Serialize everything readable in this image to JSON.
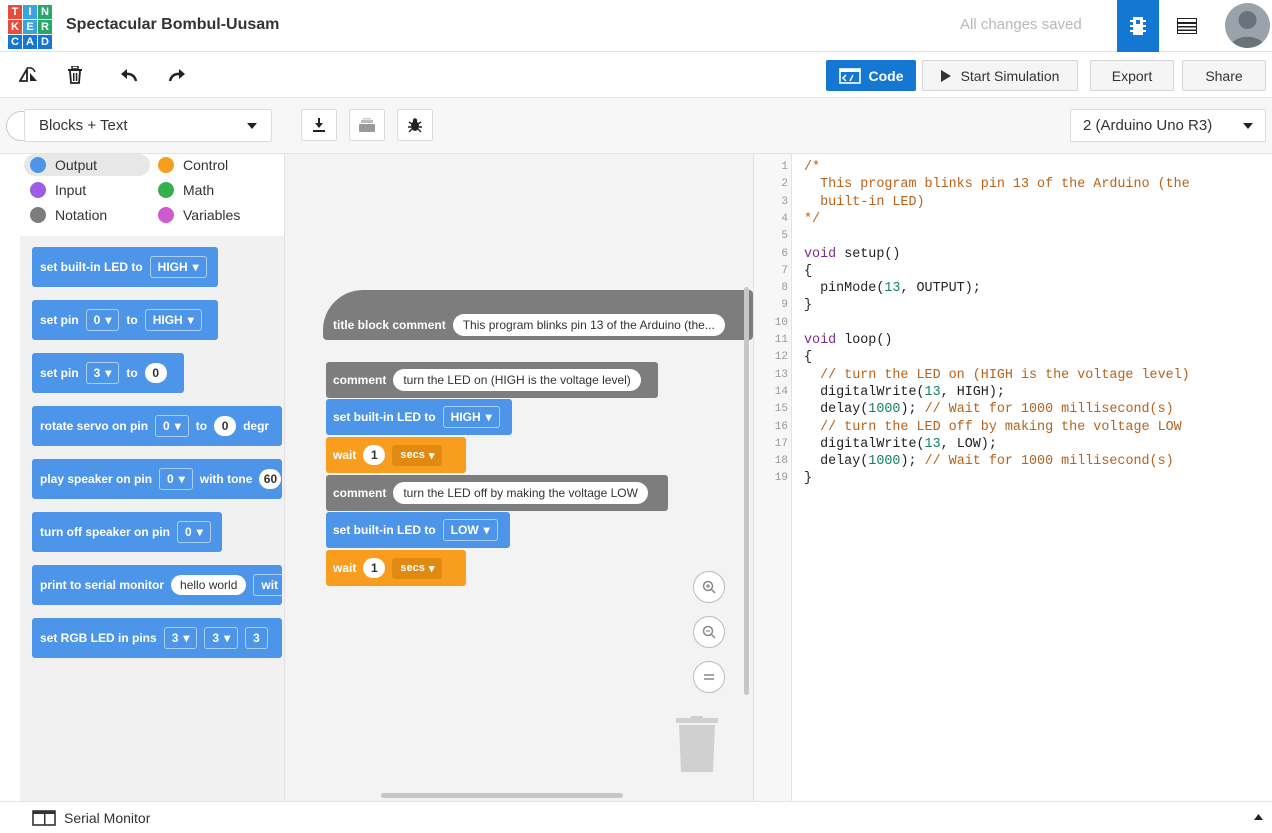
{
  "header": {
    "logo_letters": [
      "T",
      "I",
      "N",
      "K",
      "E",
      "R",
      "C",
      "A",
      "D"
    ],
    "logo_colors": [
      "#e64d3d",
      "#3aa5dc",
      "#27a86a",
      "#e64d3d",
      "#3aa5dc",
      "#27a86a",
      "#1477d2",
      "#1477d2",
      "#1477d2"
    ],
    "project_title": "Spectacular Bombul-Uusam",
    "save_status": "All changes saved"
  },
  "toolbar": {
    "code_label": "Code",
    "simulate_label": "Start Simulation",
    "export_label": "Export",
    "share_label": "Share"
  },
  "panel": {
    "mode": "Blocks + Text",
    "board": "2 (Arduino Uno R3)"
  },
  "categories": [
    {
      "label": "Output",
      "color": "#4d95e8",
      "selected": true
    },
    {
      "label": "Control",
      "color": "#f89d1d"
    },
    {
      "label": "Input",
      "color": "#9b5de5"
    },
    {
      "label": "Math",
      "color": "#35b14b"
    },
    {
      "label": "Notation",
      "color": "#7d7d7d"
    },
    {
      "label": "Variables",
      "color": "#cf5bd3"
    }
  ],
  "palette_blocks": {
    "b1": {
      "text": "set built-in LED to",
      "dd": "HIGH"
    },
    "b2": {
      "text": "set pin",
      "dd1": "0",
      "to": "to",
      "dd2": "HIGH"
    },
    "b3": {
      "text": "set pin",
      "dd1": "3",
      "to": "to",
      "val": "0"
    },
    "b4": {
      "text": "rotate servo on pin",
      "dd1": "0",
      "to": "to",
      "val": "0",
      "tail": "degr"
    },
    "b5": {
      "text": "play speaker on pin",
      "dd1": "0",
      "tail": "with tone",
      "val": "60"
    },
    "b6": {
      "text": "turn off speaker on pin",
      "dd1": "0"
    },
    "b7": {
      "text": "print to serial monitor",
      "val": "hello world",
      "tail": "wit"
    },
    "b8": {
      "text": "set RGB LED in pins",
      "dd1": "3",
      "dd2": "3",
      "dd3": "3"
    }
  },
  "workspace": {
    "title_block": {
      "text": "title block comment",
      "value": "This program blinks pin 13 of the Arduino (the..."
    },
    "comment1": {
      "text": "comment",
      "value": "turn the LED on (HIGH is the voltage level)"
    },
    "set1": {
      "text": "set built-in LED to",
      "dd": "HIGH"
    },
    "wait1": {
      "text": "wait",
      "val": "1",
      "unit": "secs"
    },
    "comment2": {
      "text": "comment",
      "value": "turn the LED off by making the voltage LOW"
    },
    "set2": {
      "text": "set built-in LED to",
      "dd": "LOW"
    },
    "wait2": {
      "text": "wait",
      "val": "1",
      "unit": "secs"
    }
  },
  "code_lines": [
    {
      "n": "1",
      "parts": [
        {
          "t": "/*",
          "c": "c"
        }
      ]
    },
    {
      "n": "2",
      "parts": [
        {
          "t": "  This program blinks pin 13 of the Arduino (the",
          "c": "c"
        }
      ]
    },
    {
      "n": "3",
      "parts": [
        {
          "t": "  built-in LED)",
          "c": "c"
        }
      ]
    },
    {
      "n": "4",
      "parts": [
        {
          "t": "*/",
          "c": "c"
        }
      ]
    },
    {
      "n": "5",
      "parts": []
    },
    {
      "n": "6",
      "parts": [
        {
          "t": "void",
          "c": "kw"
        },
        {
          "t": " setup()",
          "c": ""
        }
      ]
    },
    {
      "n": "7",
      "parts": [
        {
          "t": "{",
          "c": ""
        }
      ]
    },
    {
      "n": "8",
      "parts": [
        {
          "t": "  pinMode(",
          "c": ""
        },
        {
          "t": "13",
          "c": "num"
        },
        {
          "t": ", OUTPUT);",
          "c": ""
        }
      ]
    },
    {
      "n": "9",
      "parts": [
        {
          "t": "}",
          "c": ""
        }
      ]
    },
    {
      "n": "10",
      "parts": []
    },
    {
      "n": "11",
      "parts": [
        {
          "t": "void",
          "c": "kw"
        },
        {
          "t": " loop()",
          "c": ""
        }
      ]
    },
    {
      "n": "12",
      "parts": [
        {
          "t": "{",
          "c": ""
        }
      ]
    },
    {
      "n": "13",
      "parts": [
        {
          "t": "  // turn the LED on (HIGH is the voltage level)",
          "c": "c"
        }
      ]
    },
    {
      "n": "14",
      "parts": [
        {
          "t": "  digitalWrite(",
          "c": ""
        },
        {
          "t": "13",
          "c": "num"
        },
        {
          "t": ", HIGH);",
          "c": ""
        }
      ]
    },
    {
      "n": "15",
      "parts": [
        {
          "t": "  delay(",
          "c": ""
        },
        {
          "t": "1000",
          "c": "num"
        },
        {
          "t": "); ",
          "c": ""
        },
        {
          "t": "// Wait for 1000 millisecond(s)",
          "c": "c"
        }
      ]
    },
    {
      "n": "16",
      "parts": [
        {
          "t": "  // turn the LED off by making the voltage LOW",
          "c": "c"
        }
      ]
    },
    {
      "n": "17",
      "parts": [
        {
          "t": "  digitalWrite(",
          "c": ""
        },
        {
          "t": "13",
          "c": "num"
        },
        {
          "t": ", LOW);",
          "c": ""
        }
      ]
    },
    {
      "n": "18",
      "parts": [
        {
          "t": "  delay(",
          "c": ""
        },
        {
          "t": "1000",
          "c": "num"
        },
        {
          "t": "); ",
          "c": ""
        },
        {
          "t": "// Wait for 1000 millisecond(s)",
          "c": "c"
        }
      ]
    },
    {
      "n": "19",
      "parts": [
        {
          "t": "}",
          "c": ""
        }
      ]
    }
  ],
  "footer": {
    "serial_monitor_label": "Serial Monitor"
  }
}
